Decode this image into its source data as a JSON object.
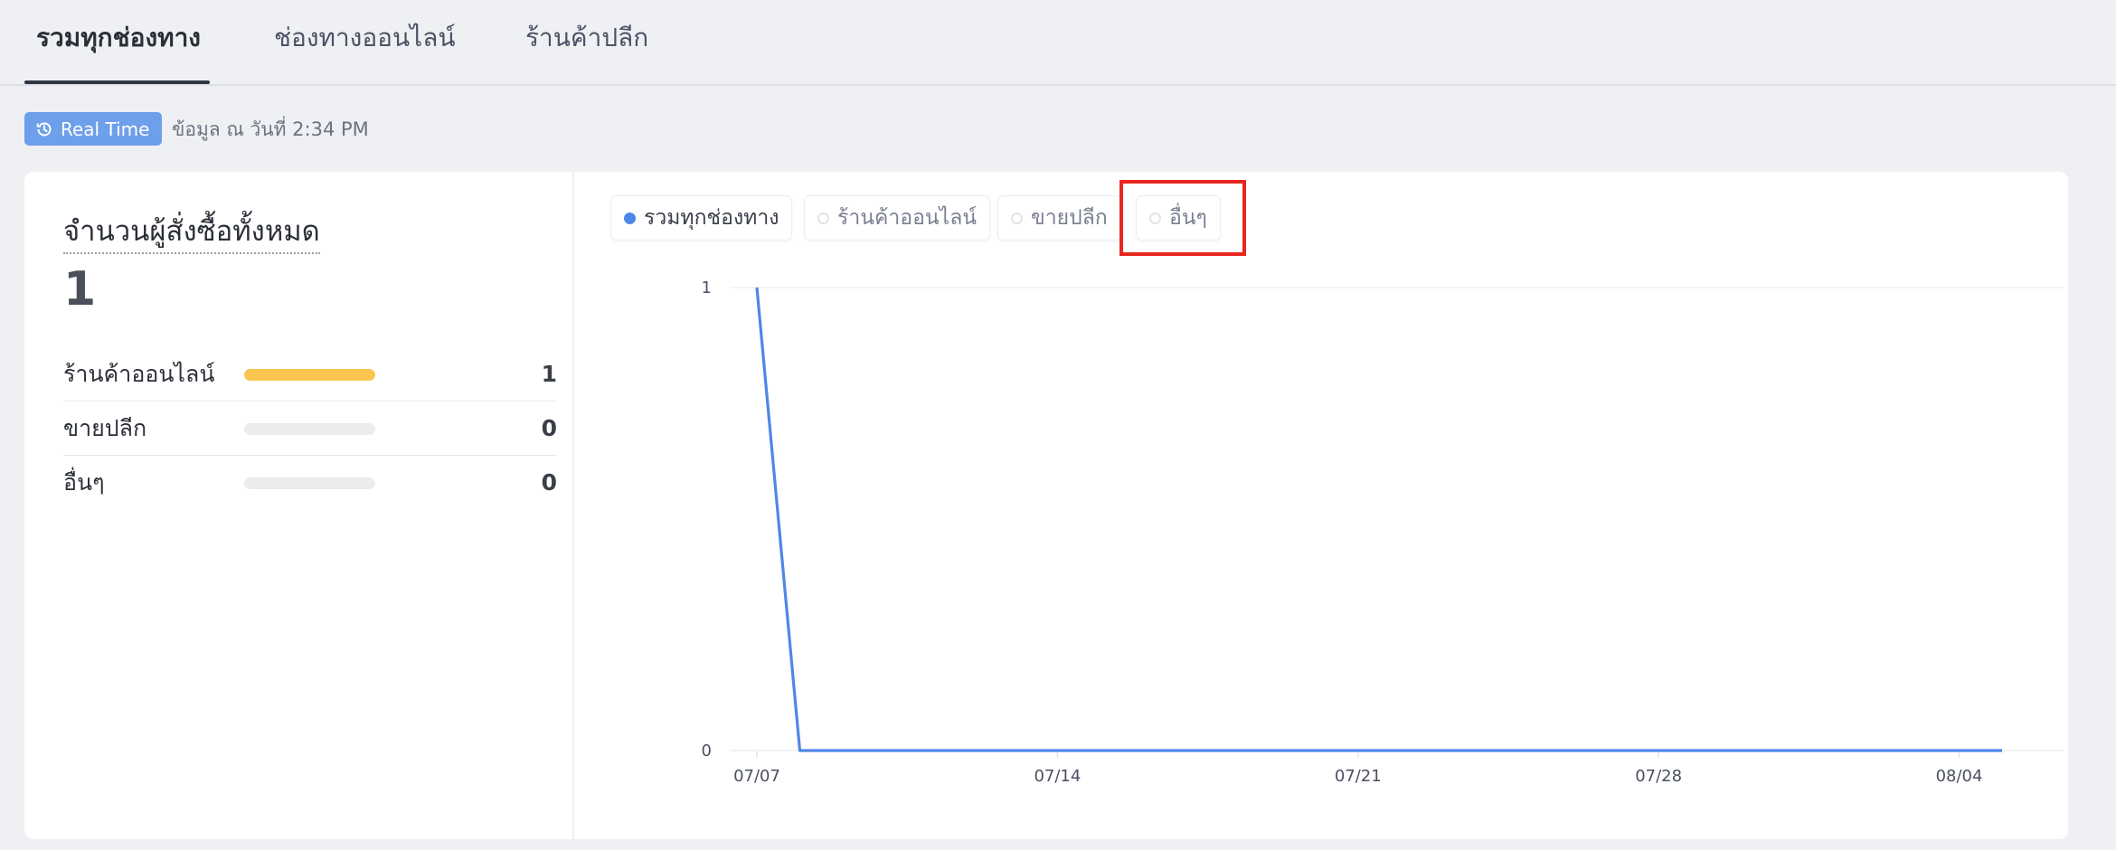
{
  "tabs": [
    {
      "label": "รวมทุกช่องทาง",
      "active": true
    },
    {
      "label": "ช่องทางออนไลน์",
      "active": false
    },
    {
      "label": "ร้านค้าปลีก",
      "active": false
    }
  ],
  "realtime": {
    "badge": "Real Time",
    "timestamp": "ข้อมูล ณ วันที่ 2:34 PM",
    "icon": "history-clock-icon"
  },
  "summary": {
    "title": "จำนวนผู้สั่งซื้อทั้งหมด",
    "total": "1",
    "channels": [
      {
        "name": "ร้านค้าออนไลน์",
        "value": "1",
        "share": 1.0
      },
      {
        "name": "ขายปลีก",
        "value": "0",
        "share": 0.0
      },
      {
        "name": "อื่นๆ",
        "value": "0",
        "share": 0.0
      }
    ]
  },
  "legend": [
    {
      "label": "รวมทุกช่องทาง",
      "selected": true
    },
    {
      "label": "ร้านค้าออนไลน์",
      "selected": false
    },
    {
      "label": "ขายปลีก",
      "selected": false
    },
    {
      "label": "อื่นๆ",
      "selected": false,
      "highlighted": true
    }
  ],
  "colors": {
    "accent": "#4f86e8",
    "online_bar": "#f9c54e",
    "highlight": "#e8261e",
    "badge": "#6e9fea"
  },
  "chart_data": {
    "type": "line",
    "x_ticks": [
      "07/07",
      "07/14",
      "07/21",
      "07/28",
      "08/04"
    ],
    "y_ticks": [
      "0",
      "1"
    ],
    "ylim": [
      0,
      1
    ],
    "x_days_range": [
      0,
      29
    ],
    "series": [
      {
        "name": "รวมทุกช่องทาง",
        "color": "#4f86e8",
        "values": [
          1,
          0,
          0,
          0,
          0,
          0,
          0,
          0,
          0,
          0,
          0,
          0,
          0,
          0,
          0,
          0,
          0,
          0,
          0,
          0,
          0,
          0,
          0,
          0,
          0,
          0,
          0,
          0,
          0,
          0
        ]
      }
    ]
  }
}
